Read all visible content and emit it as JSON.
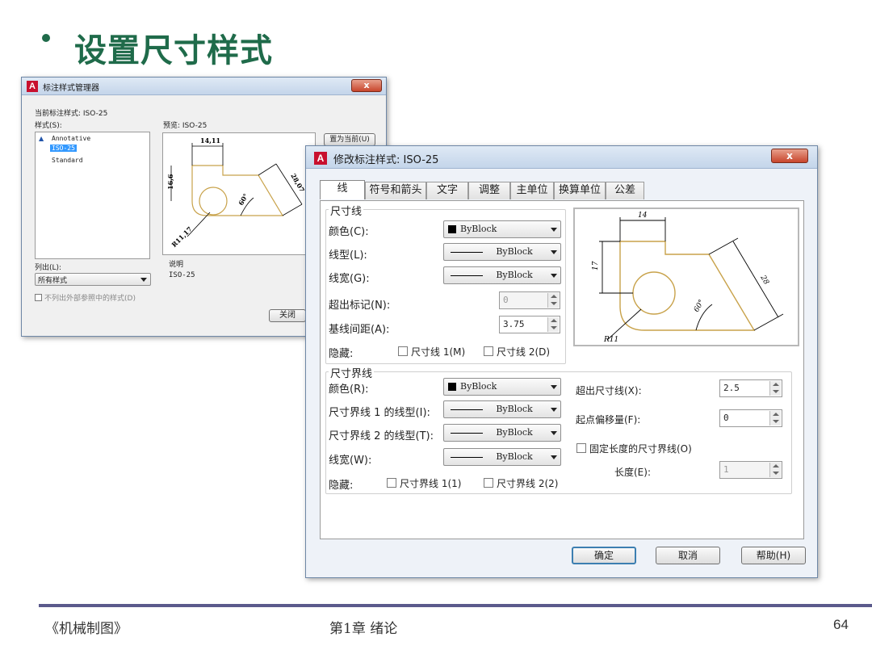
{
  "slide": {
    "title": "设置尺寸样式",
    "footer_left": "《机械制图》",
    "footer_center": "第1章  绪论",
    "page_number": "64"
  },
  "manager": {
    "title": "标注样式管理器",
    "current_style_label": "当前标注样式: ISO-25",
    "styles_label": "样式(S):",
    "styles": [
      "Annotative",
      "ISO-25",
      "Standard"
    ],
    "selected_style": "ISO-25",
    "preview_label": "预览: ISO-25",
    "set_current_button": "置为当前(U)",
    "list_label": "列出(L):",
    "list_value": "所有样式",
    "exclude_xref_label": "不列出外部参照中的样式(D)",
    "description_label": "说明",
    "description_value": "ISO-25",
    "close_button": "关闭",
    "preview_dims": [
      "14,11",
      "16,6",
      "28,07",
      "60°",
      "R11,17"
    ]
  },
  "modify": {
    "title": "修改标注样式: ISO-25",
    "tabs": [
      "线",
      "符号和箭头",
      "文字",
      "调整",
      "主单位",
      "换算单位",
      "公差"
    ],
    "active_tab": "线",
    "dim_lines": {
      "group_title": "尺寸线",
      "color_label": "颜色(C):",
      "color_value": "ByBlock",
      "linetype_label": "线型(L):",
      "linetype_value": "ByBlock",
      "lineweight_label": "线宽(G):",
      "lineweight_value": "ByBlock",
      "extend_ticks_label": "超出标记(N):",
      "extend_ticks_value": "0",
      "baseline_spacing_label": "基线间距(A):",
      "baseline_spacing_value": "3.75",
      "suppress_label": "隐藏:",
      "suppress_1": "尺寸线 1(M)",
      "suppress_2": "尺寸线 2(D)"
    },
    "ext_lines": {
      "group_title": "尺寸界线",
      "color_label": "颜色(R):",
      "color_value": "ByBlock",
      "linetype1_label": "尺寸界线 1 的线型(I):",
      "linetype1_value": "ByBlock",
      "linetype2_label": "尺寸界线 2 的线型(T):",
      "linetype2_value": "ByBlock",
      "lineweight_label": "线宽(W):",
      "lineweight_value": "ByBlock",
      "suppress_label": "隐藏:",
      "suppress_1": "尺寸界线 1(1)",
      "suppress_2": "尺寸界线 2(2)",
      "extend_beyond_label": "超出尺寸线(X):",
      "extend_beyond_value": "2.5",
      "offset_label": "起点偏移量(F):",
      "offset_value": "0",
      "fixed_length_label": "固定长度的尺寸界线(O)",
      "length_label": "长度(E):",
      "length_value": "1"
    },
    "preview_dims": [
      "14",
      "17",
      "28",
      "60°",
      "R11"
    ],
    "ok_button": "确定",
    "cancel_button": "取消",
    "help_button": "帮助(H)"
  },
  "colors": {
    "title_green": "#1f6b4a",
    "footer_rule": "#5b5a8c",
    "drawing_line": "#c8a24a",
    "selection": "#3399ff"
  }
}
